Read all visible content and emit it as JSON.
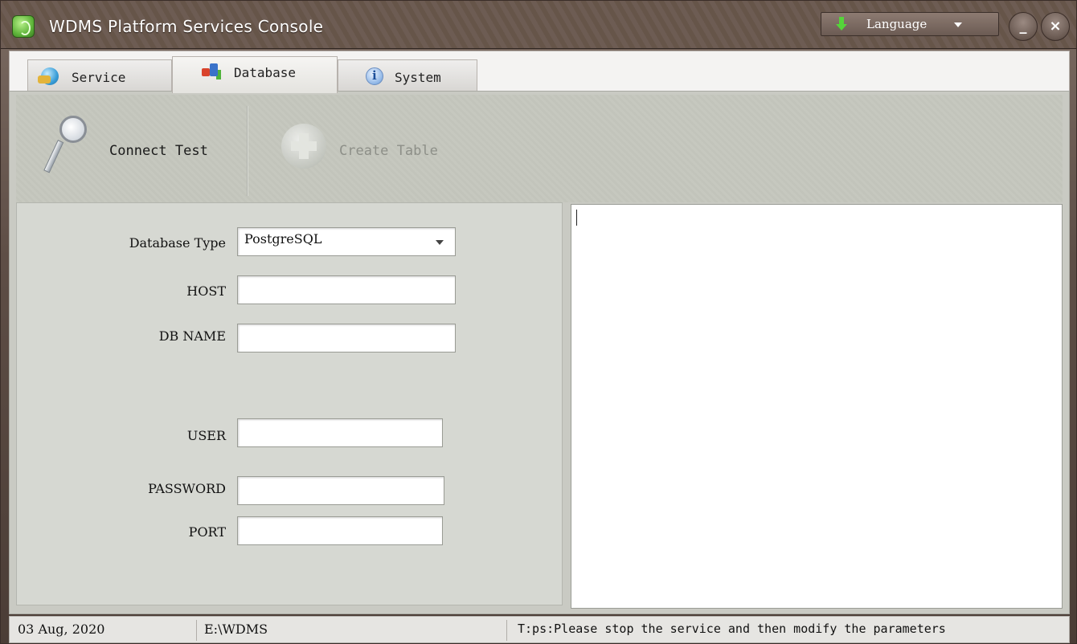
{
  "window": {
    "title": "WDMS Platform Services Console",
    "language_label": "Language"
  },
  "tabs": [
    {
      "label": "Service",
      "icon": "service-icon",
      "active": false
    },
    {
      "label": "Database",
      "icon": "database-icon",
      "active": true
    },
    {
      "label": "System",
      "icon": "info-icon",
      "active": false
    }
  ],
  "toolbar": {
    "connect_test": "Connect Test",
    "create_table": "Create Table"
  },
  "form": {
    "database_type": {
      "label": "Database Type",
      "value": "PostgreSQL"
    },
    "host": {
      "label": "HOST",
      "value": ""
    },
    "db_name": {
      "label": "DB NAME",
      "value": ""
    },
    "user": {
      "label": "USER",
      "value": ""
    },
    "password": {
      "label": "PASSWORD",
      "value": ""
    },
    "port": {
      "label": "PORT",
      "value": ""
    }
  },
  "log": {
    "text": ""
  },
  "status": {
    "date": "03 Aug, 2020",
    "path": "E:\\WDMS",
    "tip": "T:ps:Please stop the service and then modify the parameters"
  },
  "colors": {
    "title_bar": "#6d5c53",
    "toolbar": "#c6c8bf",
    "accent_green": "#55d43a"
  }
}
